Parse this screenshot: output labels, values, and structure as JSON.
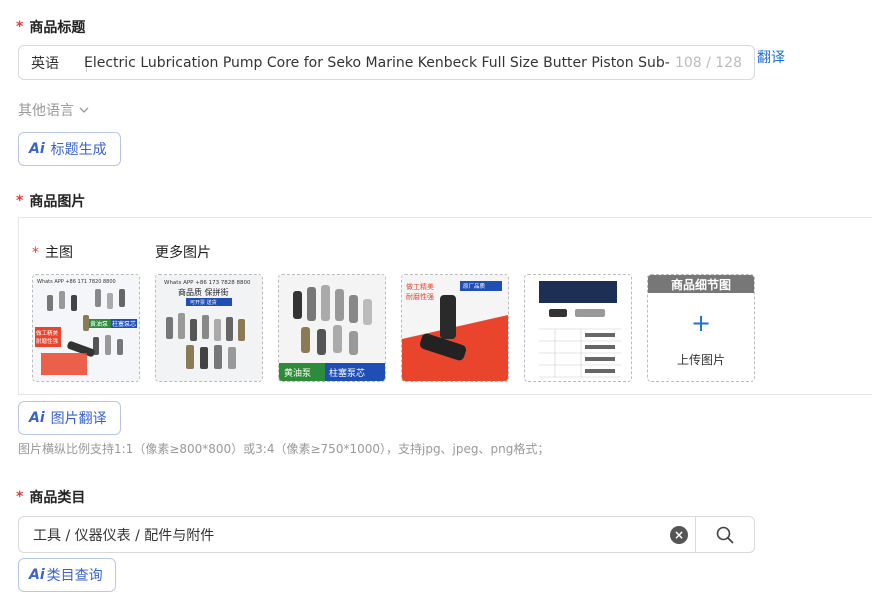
{
  "title_section": {
    "required_mark": "*",
    "label": "商品标题",
    "lang": "英语",
    "value": "Electric Lubrication Pump Core for Seko Marine Kenbeck Full Size Butter Piston Sub-Co",
    "counter": "108 / 128",
    "translate_link": "翻译",
    "other_lang": "其他语言",
    "ai_button": {
      "ai": "Ai",
      "label": "标题生成"
    }
  },
  "image_section": {
    "required_mark": "*",
    "label": "商品图片",
    "main_label": "主图",
    "more_label": "更多图片",
    "thumb1_texts": [
      "Whats APP +86 171 7820 8800",
      "黄油泵",
      "柱塞泵芯",
      "做工精美",
      "耐磨性强"
    ],
    "thumb2_texts": [
      "Whats APP +86 173 7828 8800",
      "商品质 保拼街",
      "可开票  送货"
    ],
    "thumb3_texts": [
      "黄油泵",
      "柱塞泵芯"
    ],
    "thumb4_texts": [
      "做工精美",
      "耐磨性强",
      "原厂品质"
    ],
    "detail_header": "商品细节图",
    "plus": "+",
    "upload_label": "上传图片",
    "ai_button": {
      "ai": "Ai",
      "label": "图片翻译"
    },
    "hint": "图片横纵比例支持1:1（像素≥800*800）或3:4（像素≥750*1000），支持jpg、jpeg、png格式；"
  },
  "category_section": {
    "required_mark": "*",
    "label": "商品类目",
    "value": "工具 / 仪器仪表 / 配件与附件",
    "clear_icon": "×",
    "ai_button": {
      "ai": "Ai",
      "label": "类目查询"
    }
  },
  "colors": {
    "accent": "#1f6fd6",
    "required": "#e4393c",
    "ai_text": "#3a62c9"
  }
}
